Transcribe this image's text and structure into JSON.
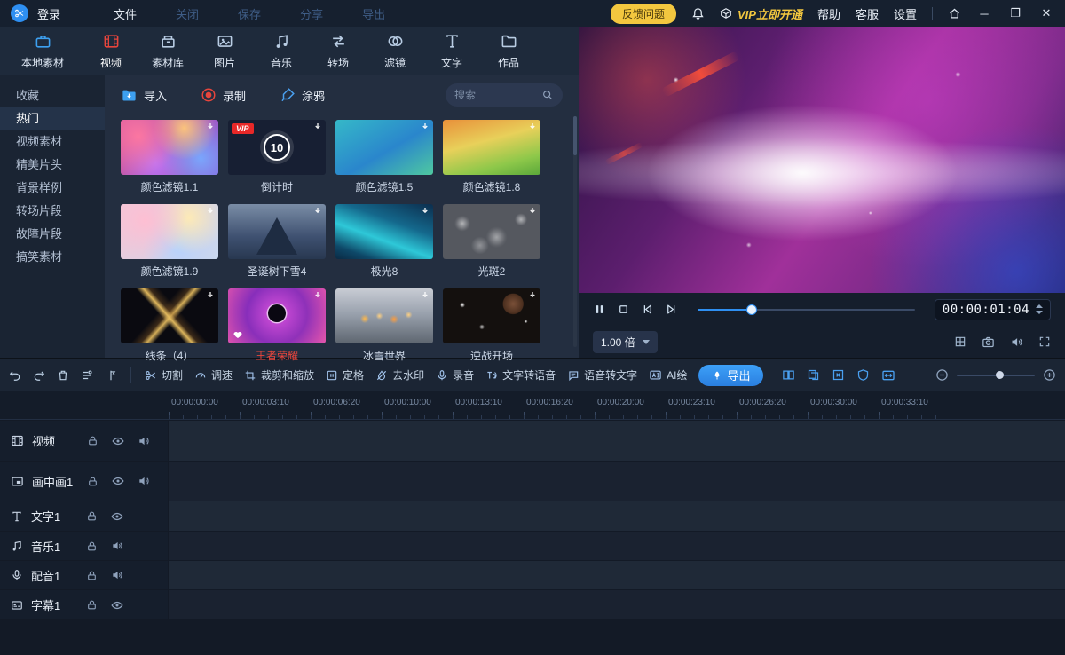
{
  "titlebar": {
    "login_label": "登录",
    "menu_file": "文件",
    "menu_close": "关闭",
    "menu_save": "保存",
    "menu_share": "分享",
    "menu_export": "导出",
    "feedback_label": "反馈问题",
    "vip_label": "VIP立即开通",
    "help_label": "帮助",
    "support_label": "客服",
    "settings_label": "设置"
  },
  "tabs": [
    {
      "label": "本地素材"
    },
    {
      "label": "视频"
    },
    {
      "label": "素材库"
    },
    {
      "label": "图片"
    },
    {
      "label": "音乐"
    },
    {
      "label": "转场"
    },
    {
      "label": "滤镜"
    },
    {
      "label": "文字"
    },
    {
      "label": "作品"
    }
  ],
  "sidebar": {
    "items": [
      {
        "label": "收藏"
      },
      {
        "label": "热门"
      },
      {
        "label": "视频素材"
      },
      {
        "label": "精美片头"
      },
      {
        "label": "背景样例"
      },
      {
        "label": "转场片段"
      },
      {
        "label": "故障片段"
      },
      {
        "label": "搞笑素材"
      }
    ]
  },
  "library": {
    "import_label": "导入",
    "record_label": "录制",
    "doodle_label": "涂鸦",
    "search_placeholder": "搜索",
    "items": [
      {
        "label": "颜色滤镜1.1"
      },
      {
        "label": "倒计时",
        "badge": "VIP",
        "number": "10"
      },
      {
        "label": "颜色滤镜1.5"
      },
      {
        "label": "颜色滤镜1.8"
      },
      {
        "label": "颜色滤镜1.9"
      },
      {
        "label": "圣诞树下雪4"
      },
      {
        "label": "极光8"
      },
      {
        "label": "光斑2"
      },
      {
        "label": "线条（4）"
      },
      {
        "label": "王者荣耀"
      },
      {
        "label": "冰雪世界"
      },
      {
        "label": "逆战开场"
      }
    ]
  },
  "preview": {
    "timecode": "00:00:01:04",
    "speed_value": "1.00 倍"
  },
  "toolbar": {
    "tools": [
      {
        "label": "切割"
      },
      {
        "label": "调速"
      },
      {
        "label": "裁剪和缩放"
      },
      {
        "label": "定格"
      },
      {
        "label": "去水印"
      },
      {
        "label": "录音"
      },
      {
        "label": "文字转语音"
      },
      {
        "label": "语音转文字"
      },
      {
        "label": "AI绘"
      }
    ],
    "export_label": "导出"
  },
  "timeline": {
    "ticks": [
      {
        "t": "00:00:00:00"
      },
      {
        "t": "00:00:03:10"
      },
      {
        "t": "00:00:06:20"
      },
      {
        "t": "00:00:10:00"
      },
      {
        "t": "00:00:13:10"
      },
      {
        "t": "00:00:16:20"
      },
      {
        "t": "00:00:20:00"
      },
      {
        "t": "00:00:23:10"
      },
      {
        "t": "00:00:26:20"
      },
      {
        "t": "00:00:30:00"
      },
      {
        "t": "00:00:33:10"
      }
    ],
    "tracks": [
      {
        "label": "视频"
      },
      {
        "label": "画中画1"
      },
      {
        "label": "文字1"
      },
      {
        "label": "音乐1"
      },
      {
        "label": "配音1"
      },
      {
        "label": "字幕1"
      }
    ]
  },
  "colors": {
    "accent_blue": "#2e8ff2",
    "vip_yellow": "#f3c73f",
    "alert_red": "#e8453c"
  }
}
